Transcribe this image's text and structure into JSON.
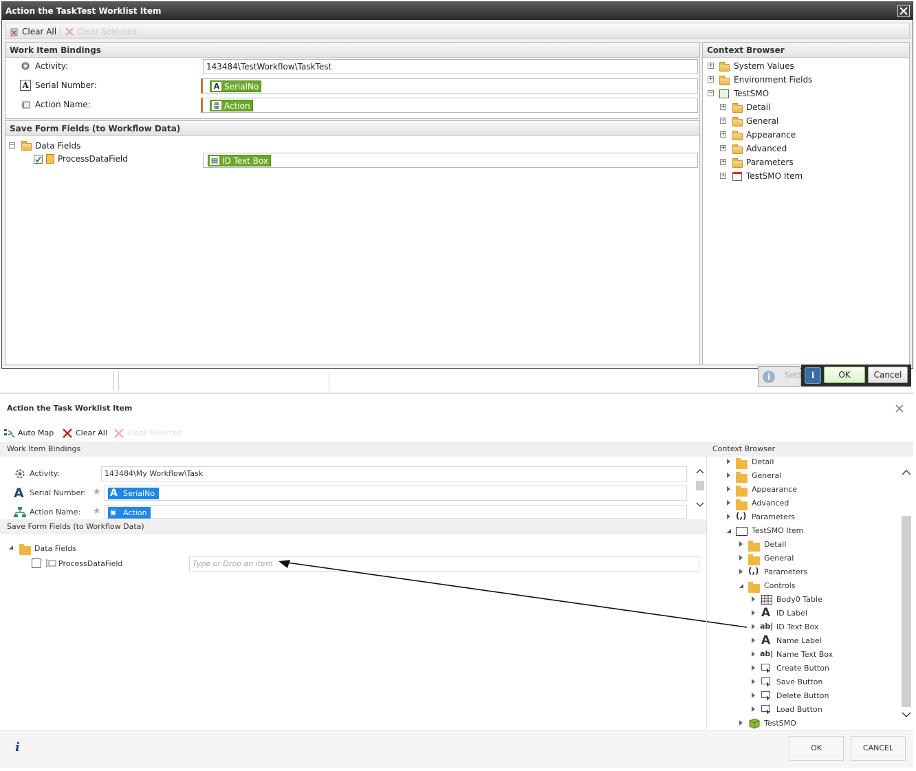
{
  "top": {
    "title": "Action the TaskTest Worklist Item",
    "toolbar": {
      "clear_all": "Clear All",
      "clear_selected": "Clear Selected"
    },
    "bindings": {
      "header": "Work Item Bindings",
      "activity_label": "Activity:",
      "activity_value": "143484\\TestWorkflow\\TaskTest",
      "serial_label": "Serial Number:",
      "serial_value": "SerialNo",
      "action_label": "Action Name:",
      "action_value": "Action"
    },
    "save_fields": {
      "header": "Save Form Fields (to Workflow Data)",
      "data_fields": "Data Fields",
      "process_field": "ProcessDataField",
      "process_value": "ID Text Box",
      "process_checked": true
    },
    "context": {
      "header": "Context Browser",
      "items": [
        {
          "label": "System Values"
        },
        {
          "label": "Environment Fields"
        },
        {
          "label": "TestSMO"
        },
        {
          "label": "Detail"
        },
        {
          "label": "General"
        },
        {
          "label": "Appearance"
        },
        {
          "label": "Advanced"
        },
        {
          "label": "Parameters"
        },
        {
          "label": "TestSMO Item"
        }
      ]
    },
    "footer": {
      "settings_partial": "Setti",
      "ok": "OK",
      "cancel": "Cancel"
    }
  },
  "bottom": {
    "title": "Action the Task Worklist Item",
    "toolbar": {
      "auto_map": "Auto Map",
      "clear_all": "Clear All",
      "clear_selected": "Clear Selected"
    },
    "bindings": {
      "header": "Work Item Bindings",
      "activity_label": "Activity:",
      "activity_value": "143484\\My Workflow\\Task",
      "serial_label": "Serial Number:",
      "serial_value": "SerialNo",
      "action_label": "Action Name:",
      "action_value": "Action"
    },
    "save_fields": {
      "header": "Save Form Fields (to Workflow Data)",
      "data_fields": "Data Fields",
      "process_field": "ProcessDataField",
      "process_placeholder": "Type or Drop an item",
      "process_checked": false
    },
    "context": {
      "header": "Context Browser",
      "items": [
        {
          "label": "Detail"
        },
        {
          "label": "General"
        },
        {
          "label": "Appearance"
        },
        {
          "label": "Advanced"
        },
        {
          "label": "Parameters"
        },
        {
          "label": "TestSMO Item"
        },
        {
          "label": "Detail"
        },
        {
          "label": "General"
        },
        {
          "label": "Parameters"
        },
        {
          "label": "Controls"
        },
        {
          "label": "Body0 Table"
        },
        {
          "label": "ID Label"
        },
        {
          "label": "ID Text Box"
        },
        {
          "label": "Name Label"
        },
        {
          "label": "Name Text Box"
        },
        {
          "label": "Create Button"
        },
        {
          "label": "Save Button"
        },
        {
          "label": "Delete Button"
        },
        {
          "label": "Load Button"
        },
        {
          "label": "TestSMO"
        }
      ]
    },
    "footer": {
      "info": "i",
      "ok": "OK",
      "cancel": "CANCEL"
    }
  },
  "colors": {
    "green_tag": "#6aa82a",
    "blue_tag": "#1e88e5",
    "title_bar": "#2b2b2b"
  }
}
